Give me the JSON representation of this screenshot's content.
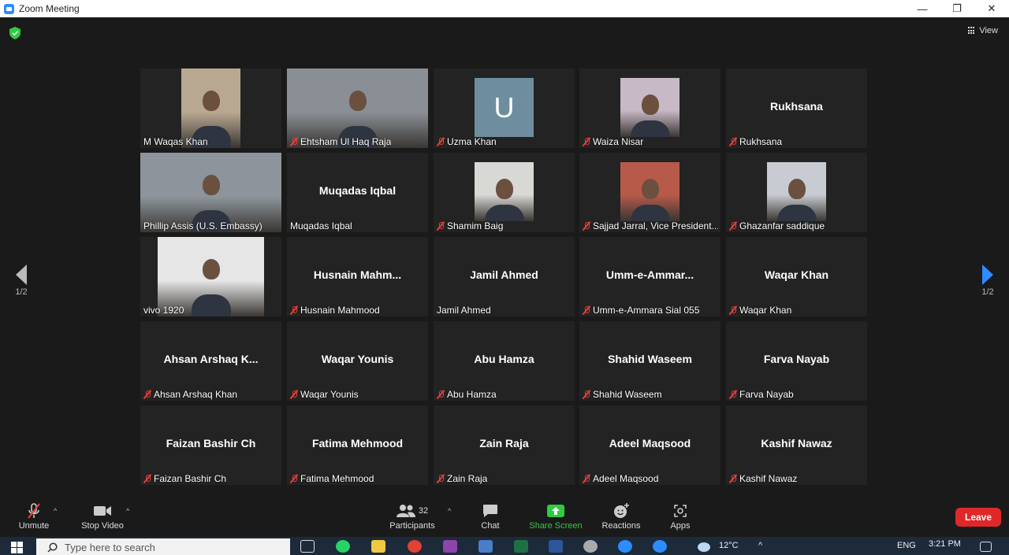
{
  "window": {
    "title": "Zoom Meeting",
    "minimize": "—",
    "restore": "❐",
    "close": "✕"
  },
  "top": {
    "view_label": "View"
  },
  "nav": {
    "prev_page": "1/2",
    "next_page": "1/2"
  },
  "tiles": [
    {
      "label": "M Waqas Khan",
      "big": "",
      "muted": false,
      "video": true,
      "bg": "#b9a891"
    },
    {
      "label": "Ehtsham Ul Haq Raja",
      "big": "",
      "muted": true,
      "video": true,
      "bg": "#8a8f96"
    },
    {
      "label": "Uzma Khan",
      "big": "",
      "muted": true,
      "video": false,
      "avatar": "U"
    },
    {
      "label": "Waiza Nisar",
      "big": "",
      "muted": true,
      "video": true,
      "bg": "#c8b9c6"
    },
    {
      "label": "Rukhsana",
      "big": "Rukhsana",
      "muted": true,
      "video": false
    },
    {
      "label": "Phillip Assis (U.S. Embassy)",
      "big": "",
      "muted": false,
      "video": true,
      "bg": "#8d949b",
      "active": true
    },
    {
      "label": "Muqadas Iqbal",
      "big": "Muqadas Iqbal",
      "muted": false,
      "video": false
    },
    {
      "label": "Shamim Baig",
      "big": "",
      "muted": true,
      "video": true,
      "bg": "#d8d8d4"
    },
    {
      "label": "Sajjad Jarral, Vice President...",
      "big": "",
      "muted": true,
      "video": true,
      "bg": "#b85a4a"
    },
    {
      "label": "Ghazanfar saddique",
      "big": "",
      "muted": true,
      "video": true,
      "bg": "#c8ccd2"
    },
    {
      "label": "vivo 1920",
      "big": "",
      "muted": false,
      "video": true,
      "bg": "#e6e6e6"
    },
    {
      "label": "Husnain Mahmood",
      "big": "Husnain  Mahm...",
      "muted": true,
      "video": false
    },
    {
      "label": "Jamil Ahmed",
      "big": "Jamil Ahmed",
      "muted": false,
      "video": false
    },
    {
      "label": "Umm-e-Ammara Sial 055",
      "big": "Umm-e-Ammar...",
      "muted": true,
      "video": false
    },
    {
      "label": "Waqar Khan",
      "big": "Waqar Khan",
      "muted": true,
      "video": false
    },
    {
      "label": "Ahsan Arshaq Khan",
      "big": "Ahsan Arshaq K...",
      "muted": true,
      "video": false
    },
    {
      "label": "Waqar Younis",
      "big": "Waqar Younis",
      "muted": true,
      "video": false
    },
    {
      "label": "Abu Hamza",
      "big": "Abu Hamza",
      "muted": true,
      "video": false
    },
    {
      "label": "Shahid Waseem",
      "big": "Shahid Waseem",
      "muted": true,
      "video": false
    },
    {
      "label": "Farva Nayab",
      "big": "Farva Nayab",
      "muted": true,
      "video": false
    },
    {
      "label": "Faizan Bashir Ch",
      "big": "Faizan Bashir Ch",
      "muted": true,
      "video": false
    },
    {
      "label": "Fatima Mehmood",
      "big": "Fatima Mehmood",
      "muted": true,
      "video": false
    },
    {
      "label": "Zain Raja",
      "big": "Zain Raja",
      "muted": true,
      "video": false
    },
    {
      "label": "Adeel Maqsood",
      "big": "Adeel Maqsood",
      "muted": true,
      "video": false
    },
    {
      "label": "Kashif Nawaz",
      "big": "Kashif Nawaz",
      "muted": true,
      "video": false
    }
  ],
  "toolbar": {
    "unmute": "Unmute",
    "stop_video": "Stop Video",
    "participants": "Participants",
    "participant_count": "32",
    "chat": "Chat",
    "share_screen": "Share Screen",
    "reactions": "Reactions",
    "apps": "Apps",
    "leave": "Leave"
  },
  "taskbar": {
    "search_placeholder": "Type here to search",
    "temperature": "12°C",
    "language": "ENG",
    "time": "3:21 PM"
  },
  "colors": {
    "share_green": "#2ecc40",
    "leave_red": "#e02828",
    "active_border": "#c9e26b",
    "mute_red": "#e6403a"
  }
}
